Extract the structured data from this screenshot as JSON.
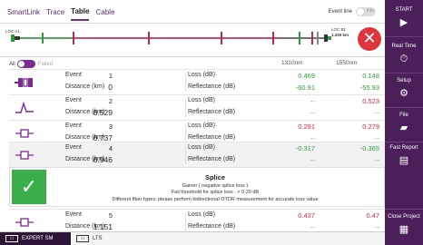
{
  "tabs": [
    "SmartLink",
    "Trace",
    "Table",
    "Cable"
  ],
  "active_tab": "Table",
  "event_lines": {
    "label": "Event line",
    "state": "Info"
  },
  "linkmap": {
    "loc_a": "LOC A1",
    "loc_b": "LOC B1",
    "loc_b_distance": "1.330 km"
  },
  "filter": {
    "all_label": "All",
    "failed_label": "Failed"
  },
  "wavelengths": [
    "1310nm",
    "1550nm"
  ],
  "labels": {
    "event": "Event",
    "distance": "Distance (km)",
    "loss": "Loss (dB)",
    "reflectance": "Reflectance (dB)"
  },
  "rows": [
    {
      "event": "1",
      "distance": "0",
      "loss_1310": "0.469",
      "loss_1550": "0.148",
      "refl_1310": "-60.91",
      "refl_1550": "-55.93",
      "icon": "connector-icon"
    },
    {
      "event": "2",
      "distance": "0.529",
      "loss_1310": "--",
      "loss_1550": "0.523",
      "refl_1310": "--",
      "refl_1550": "--",
      "icon": "reflective-event-icon"
    },
    {
      "event": "3",
      "distance": "0.737",
      "loss_1310": "0.291",
      "loss_1550": "0.279",
      "refl_1310": "--",
      "refl_1550": "--",
      "icon": "splice-icon"
    },
    {
      "event": "4",
      "distance": "0.946",
      "loss_1310": "-0.317",
      "loss_1550": "-0.365",
      "refl_1310": "--",
      "refl_1550": "--",
      "icon": "splice-icon"
    },
    {
      "event": "5",
      "distance": "1.151",
      "loss_1310": "0.437",
      "loss_1550": "0.47",
      "refl_1310": "--",
      "refl_1550": "--",
      "icon": "splice-icon"
    }
  ],
  "detail": {
    "title": "Splice",
    "line1": "Gainer ( negative splice loss )",
    "line2": "Fail threshold for splice loss : > 0.20 dB",
    "line3": "Different fiber types, please perform bidirectional OTDR measurement for accurate loss value"
  },
  "bottom_tabs": [
    "EXPERT SM",
    "LTS"
  ],
  "sidebar": {
    "start": "START",
    "real_time": "Real Time",
    "setup": "Setup",
    "file": "File",
    "fast_report": "Fast Report",
    "close_project": "Close Project"
  },
  "colors": {
    "accent": "#7b2a8f",
    "sidebar": "#4a1f5a",
    "pass": "#3aae4a",
    "fail": "#e0343d",
    "green_value": "#2e9b3e",
    "red_value": "#d8263a"
  }
}
